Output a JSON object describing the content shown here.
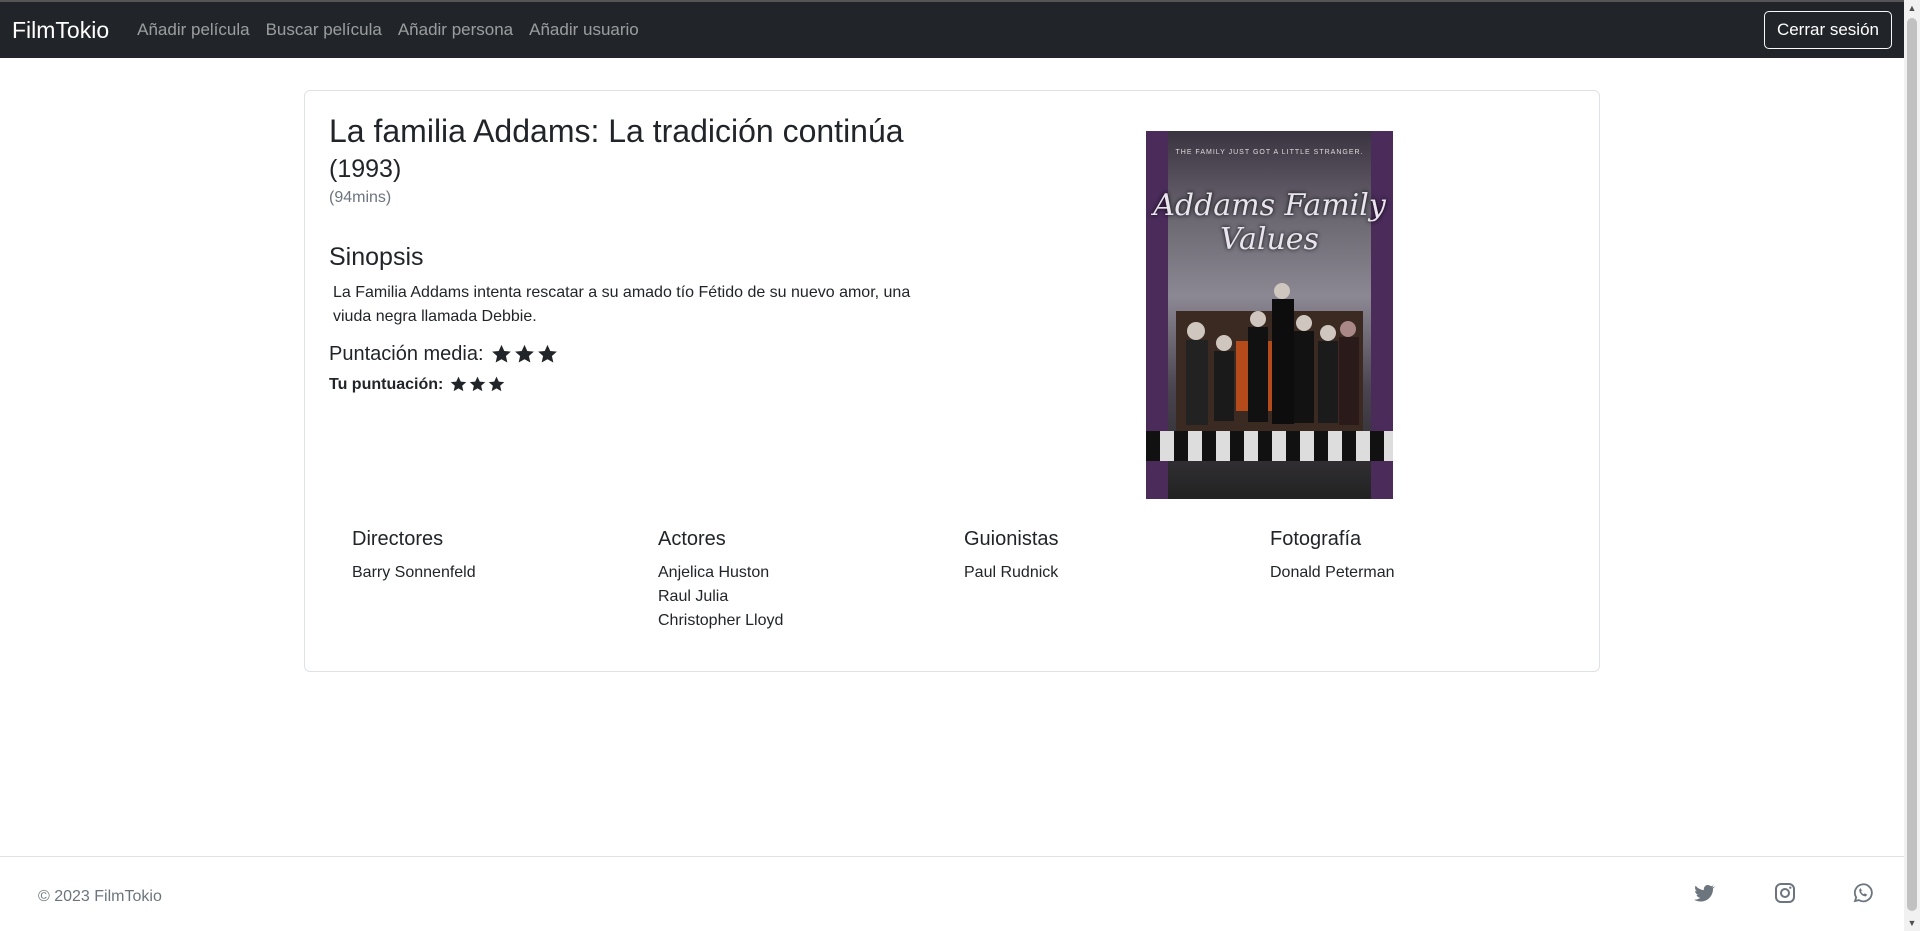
{
  "navbar": {
    "brand": "FilmTokio",
    "links": [
      "Añadir película",
      "Buscar película",
      "Añadir persona",
      "Añadir usuario"
    ],
    "logout_label": "Cerrar sesión"
  },
  "movie": {
    "title": "La familia Addams: La tradición continúa",
    "year": "(1993)",
    "duration": "(94mins)",
    "synopsis_heading": "Sinopsis",
    "synopsis": "La Familia Addams intenta rescatar a su amado tío Fétido de su nuevo amor, una viuda negra llamada Debbie.",
    "average_label": "Puntación media:",
    "average_stars": 3,
    "user_label": "Tu puntuación:",
    "user_stars": 3,
    "poster": {
      "title": "Addams Family Values",
      "tagline": "THE FAMILY JUST GOT A LITTLE STRANGER."
    }
  },
  "credits": [
    {
      "heading": "Directores",
      "names": [
        "Barry Sonnenfeld"
      ]
    },
    {
      "heading": "Actores",
      "names": [
        "Anjelica Huston",
        "Raul Julia",
        "Christopher Lloyd"
      ]
    },
    {
      "heading": "Guionistas",
      "names": [
        "Paul Rudnick"
      ]
    },
    {
      "heading": "Fotografía",
      "names": [
        "Donald Peterman"
      ]
    }
  ],
  "footer": {
    "copyright": "© 2023 FilmTokio",
    "icons": [
      "twitter-icon",
      "instagram-icon",
      "whatsapp-icon"
    ]
  },
  "colors": {
    "navbar_bg": "#212529",
    "text": "#212529",
    "muted": "#6c757d",
    "border": "#dee2e6"
  }
}
